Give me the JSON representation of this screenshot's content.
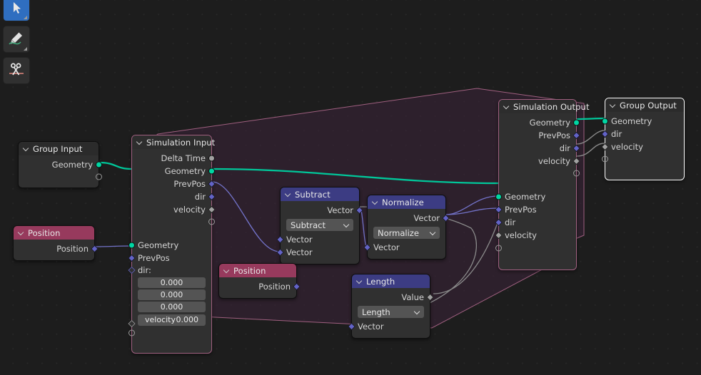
{
  "app": "blender-geometry-node-editor",
  "toolbar": {
    "buttons": [
      {
        "name": "tool-tweak",
        "label": "",
        "icon": "tweak-icon",
        "active": true
      },
      {
        "name": "tool-draw-link",
        "label": "",
        "icon": "pencil-curve-icon",
        "active": false
      },
      {
        "name": "tool-cut-links",
        "label": "",
        "icon": "scissors-icon",
        "active": false
      }
    ]
  },
  "colors": {
    "background": "#1d1d1d",
    "geometry_socket": "#00d6a3",
    "vector_socket": "#6363c7",
    "value_socket": "#a1a1a1",
    "zone_border": "#a06080",
    "header_red": "#973a5d",
    "header_blue": "#3c3c83",
    "active_outline": "#ffffff"
  },
  "nodes": {
    "group_input": {
      "title": "Group Input",
      "outputs": [
        {
          "label": "Geometry",
          "type": "geo"
        },
        {
          "label": "",
          "type": "virt"
        }
      ]
    },
    "position_left": {
      "title": "Position",
      "outputs": [
        {
          "label": "Position",
          "type": "vec"
        }
      ]
    },
    "simulation_input": {
      "title": "Simulation Input",
      "outputs": [
        {
          "label": "Delta Time",
          "type": "valcircle"
        },
        {
          "label": "Geometry",
          "type": "geo"
        },
        {
          "label": "PrevPos",
          "type": "vec"
        },
        {
          "label": "dir",
          "type": "vec"
        },
        {
          "label": "velocity",
          "type": "val"
        },
        {
          "label": "",
          "type": "virt"
        }
      ],
      "inputs": [
        {
          "label": "Geometry",
          "type": "geo"
        },
        {
          "label": "PrevPos",
          "type": "vec"
        },
        {
          "label": "dir:",
          "type": "hollow-vec"
        }
      ],
      "dir_values": [
        "0.000",
        "0.000",
        "0.000"
      ],
      "velocity_field": {
        "label": "velocity",
        "value": "0.000",
        "type": "hollow-val"
      },
      "tail_socket": {
        "label": "",
        "type": "virt"
      }
    },
    "subtract": {
      "title": "Subtract",
      "outputs": [
        {
          "label": "Vector",
          "type": "vec"
        }
      ],
      "dropdown": "Subtract",
      "inputs": [
        {
          "label": "Vector",
          "type": "vec"
        },
        {
          "label": "Vector",
          "type": "vec"
        }
      ]
    },
    "normalize": {
      "title": "Normalize",
      "outputs": [
        {
          "label": "Vector",
          "type": "vec"
        }
      ],
      "dropdown": "Normalize",
      "inputs": [
        {
          "label": "Vector",
          "type": "vec"
        }
      ]
    },
    "position_mid": {
      "title": "Position",
      "outputs": [
        {
          "label": "Position",
          "type": "vec"
        }
      ]
    },
    "length": {
      "title": "Length",
      "outputs": [
        {
          "label": "Value",
          "type": "val"
        }
      ],
      "dropdown": "Length",
      "inputs": [
        {
          "label": "Vector",
          "type": "vec"
        }
      ]
    },
    "simulation_output": {
      "title": "Simulation Output",
      "outputs": [
        {
          "label": "Geometry",
          "type": "geo"
        },
        {
          "label": "PrevPos",
          "type": "vec"
        },
        {
          "label": "dir",
          "type": "vec"
        },
        {
          "label": "velocity",
          "type": "val"
        },
        {
          "label": "",
          "type": "virt"
        }
      ],
      "inputs": [
        {
          "label": "Geometry",
          "type": "geo"
        },
        {
          "label": "PrevPos",
          "type": "vec"
        },
        {
          "label": "dir",
          "type": "vec"
        },
        {
          "label": "velocity",
          "type": "val"
        },
        {
          "label": "",
          "type": "virt"
        }
      ]
    },
    "group_output": {
      "title": "Group Output",
      "active": true,
      "inputs": [
        {
          "label": "Geometry",
          "type": "geo"
        },
        {
          "label": "dir",
          "type": "vec"
        },
        {
          "label": "velocity",
          "type": "val"
        },
        {
          "label": "",
          "type": "virt"
        }
      ]
    }
  }
}
